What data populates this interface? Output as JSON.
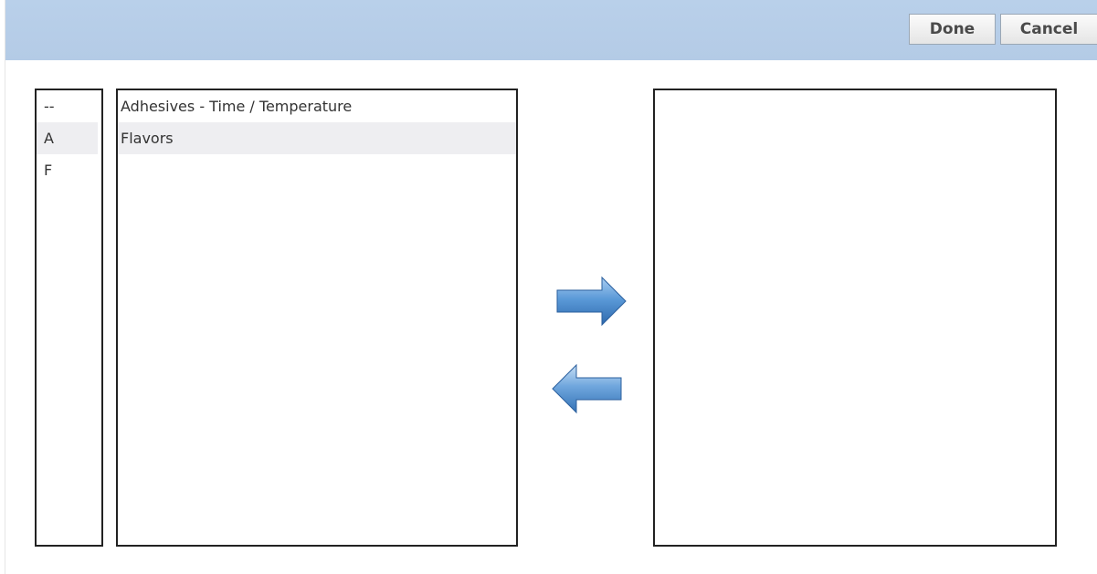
{
  "toolbar": {
    "done_label": "Done",
    "cancel_label": "Cancel",
    "background": "#b9d0ea"
  },
  "letter_filter": {
    "items": [
      {
        "label": "--",
        "highlighted": false
      },
      {
        "label": "A",
        "highlighted": true
      },
      {
        "label": "F",
        "highlighted": false
      }
    ]
  },
  "available_list": {
    "items": [
      {
        "label": "Adhesives - Time / Temperature",
        "highlighted": false
      },
      {
        "label": "Flavors",
        "highlighted": true
      }
    ]
  },
  "selected_list": {
    "items": []
  },
  "controls": {
    "move_right_icon": "arrow-right-icon",
    "move_left_icon": "arrow-left-icon",
    "arrow_color": "#3f7fc4",
    "highlight_color": "#eeeef1"
  }
}
